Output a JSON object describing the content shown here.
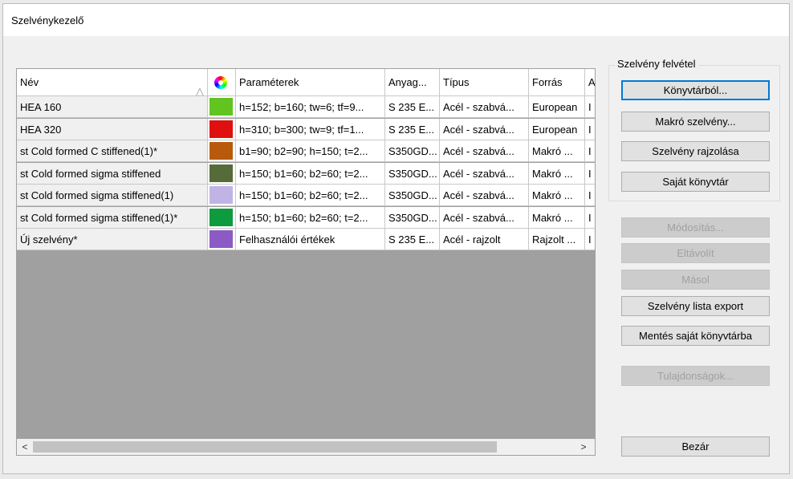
{
  "window": {
    "title": "Szelvénykezelő"
  },
  "grid": {
    "columns": [
      "Név",
      "",
      "Paraméterek",
      "Anyag...",
      "Típus",
      "Forrás",
      "A"
    ],
    "rows": [
      {
        "name": "HEA 160",
        "color": "#62c41f",
        "params": "h=152; b=160; tw=6; tf=9...",
        "material": "S 235 E...",
        "type": "Acél - szabvá...",
        "source": "European ",
        "extra": "I"
      },
      {
        "name": "HEA 320",
        "color": "#e01010",
        "params": "h=310; b=300; tw=9; tf=1...",
        "material": "S 235 E...",
        "type": "Acél - szabvá...",
        "source": "European ",
        "extra": "I"
      },
      {
        "name": "st Cold formed C stiffened(1)*",
        "color": "#b85a0c",
        "params": "b1=90; b2=90; h=150; t=2...",
        "material": "S350GD...",
        "type": "Acél - szabvá...",
        "source": "Makró ...",
        "extra": "I"
      },
      {
        "name": "st Cold formed sigma stiffened",
        "color": "#556b3a",
        "params": "h=150; b1=60; b2=60; t=2...",
        "material": "S350GD...",
        "type": "Acél - szabvá...",
        "source": "Makró ...",
        "extra": "I"
      },
      {
        "name": "st Cold formed sigma stiffened(1)",
        "color": "#c0b4e6",
        "params": "h=150; b1=60; b2=60; t=2...",
        "material": "S350GD...",
        "type": "Acél - szabvá...",
        "source": "Makró ...",
        "extra": "I"
      },
      {
        "name": "st Cold formed sigma stiffened(1)*",
        "color": "#0e9a3e",
        "params": "h=150; b1=60; b2=60; t=2...",
        "material": "S350GD...",
        "type": "Acél - szabvá...",
        "source": "Makró ...",
        "extra": "I"
      },
      {
        "name": "Új szelvény*",
        "color": "#8c5ac4",
        "params": "Felhasználói értékek",
        "material": "S 235 E...",
        "type": "Acél - rajzolt",
        "source": "Rajzolt ...",
        "extra": "I"
      }
    ]
  },
  "panel": {
    "group_label": "Szelvény felvétel",
    "buttons": {
      "from_library": "Könyvtárból...",
      "macro": "Makró szelvény...",
      "draw": "Szelvény rajzolása",
      "own_library": "Saját könyvtár",
      "modify": "Módosítás...",
      "remove": "Eltávolít",
      "copy": "Másol",
      "export": "Szelvény lista export",
      "save_own": "Mentés saját könyvtárba",
      "properties": "Tulajdonságok...",
      "close": "Bezár"
    }
  },
  "scrollbar": {
    "left": "<",
    "right": ">"
  },
  "icons": {
    "sort": "triangle-up-icon",
    "color_header": "color-wheel-icon"
  }
}
